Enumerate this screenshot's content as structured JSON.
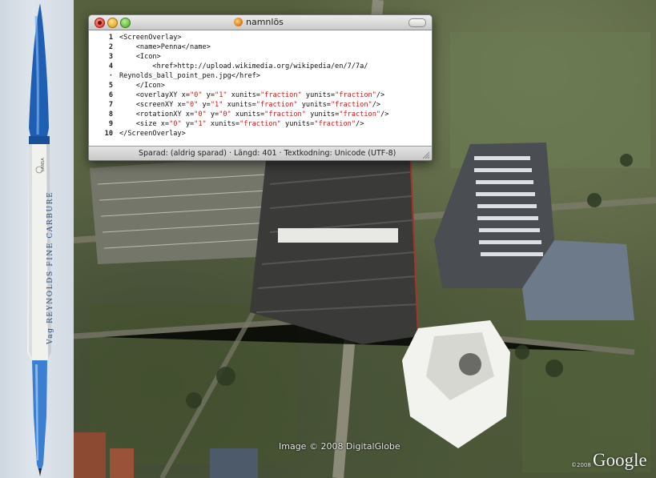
{
  "window": {
    "title": "namnlös",
    "status": "Sparad: (aldrig sparad)  ·  Längd: 401  ·  Textkodning: Unicode (UTF-8)"
  },
  "editor": {
    "lines": [
      {
        "n": "1",
        "indent": "",
        "parts": [
          {
            "t": "<ScreenOverlay>"
          }
        ]
      },
      {
        "n": "2",
        "indent": "    ",
        "parts": [
          {
            "t": "<name>Penna</name>"
          }
        ]
      },
      {
        "n": "3",
        "indent": "    ",
        "parts": [
          {
            "t": "<Icon>"
          }
        ]
      },
      {
        "n": "4",
        "indent": "        ",
        "parts": [
          {
            "t": "<href>http://upload.wikimedia.org/wikipedia/en/7/7a/"
          }
        ]
      },
      {
        "n": "·",
        "indent": "",
        "parts": [
          {
            "t": "Reynolds_ball_point_pen.jpg</href>"
          }
        ]
      },
      {
        "n": "5",
        "indent": "    ",
        "parts": [
          {
            "t": "</Icon>"
          }
        ]
      },
      {
        "n": "6",
        "indent": "    ",
        "parts": [
          {
            "t": "<overlayXY x="
          },
          {
            "t": "\"0\"",
            "s": 1
          },
          {
            "t": " y="
          },
          {
            "t": "\"1\"",
            "s": 1
          },
          {
            "t": " xunits="
          },
          {
            "t": "\"fraction\"",
            "s": 1
          },
          {
            "t": " yunits="
          },
          {
            "t": "\"fraction\"",
            "s": 1
          },
          {
            "t": "/>"
          }
        ]
      },
      {
        "n": "7",
        "indent": "    ",
        "parts": [
          {
            "t": "<screenXY x="
          },
          {
            "t": "\"0\"",
            "s": 1
          },
          {
            "t": " y="
          },
          {
            "t": "\"1\"",
            "s": 1
          },
          {
            "t": " xunits="
          },
          {
            "t": "\"fraction\"",
            "s": 1
          },
          {
            "t": " yunits="
          },
          {
            "t": "\"fraction\"",
            "s": 1
          },
          {
            "t": "/>"
          }
        ]
      },
      {
        "n": "8",
        "indent": "    ",
        "parts": [
          {
            "t": "<rotationXY x="
          },
          {
            "t": "\"0\"",
            "s": 1
          },
          {
            "t": " y="
          },
          {
            "t": "\"0\"",
            "s": 1
          },
          {
            "t": " xunits="
          },
          {
            "t": "\"fraction\"",
            "s": 1
          },
          {
            "t": " yunits="
          },
          {
            "t": "\"fraction\"",
            "s": 1
          },
          {
            "t": "/>"
          }
        ]
      },
      {
        "n": "9",
        "indent": "    ",
        "parts": [
          {
            "t": "<size x="
          },
          {
            "t": "\"0\"",
            "s": 1
          },
          {
            "t": " y="
          },
          {
            "t": "\"1\"",
            "s": 1
          },
          {
            "t": " xunits="
          },
          {
            "t": "\"fraction\"",
            "s": 1
          },
          {
            "t": " yunits="
          },
          {
            "t": "\"fraction\"",
            "s": 1
          },
          {
            "t": "/>"
          }
        ]
      },
      {
        "n": "10",
        "indent": "",
        "parts": [
          {
            "t": "</ScreenOverlay>"
          }
        ]
      }
    ]
  },
  "map": {
    "imagery_credit": "Image © 2008 DigitalGlobe",
    "logo_copyright": "©2008",
    "logo": "Google"
  },
  "pen": {
    "imprint": "Vag REYNOLDS FINE CARBURE",
    "brand_mark": "LANSA"
  },
  "colors": {
    "syntax_string": "#d11a1a",
    "pen_blue": "#1e5fb4"
  }
}
